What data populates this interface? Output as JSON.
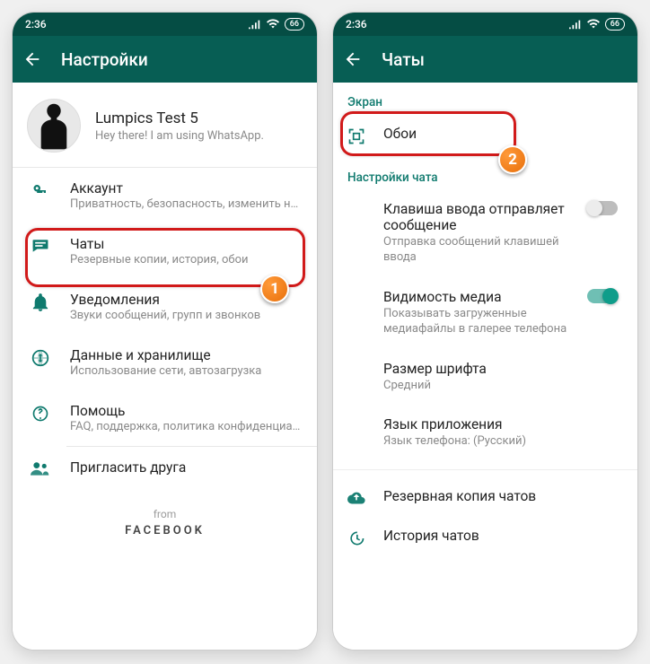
{
  "status": {
    "time": "2:36",
    "battery": "66"
  },
  "left": {
    "appbar": {
      "title": "Настройки"
    },
    "profile": {
      "name": "Lumpics Test 5",
      "status": "Hey there! I am using WhatsApp."
    },
    "items": [
      {
        "title": "Аккаунт",
        "sub": "Приватность, безопасность, изменить номер"
      },
      {
        "title": "Чаты",
        "sub": "Резервные копии, история, обои"
      },
      {
        "title": "Уведомления",
        "sub": "Звуки сообщений, групп и звонков"
      },
      {
        "title": "Данные и хранилище",
        "sub": "Использование сети, автозагрузка"
      },
      {
        "title": "Помощь",
        "sub": "FAQ, поддержка, политика конфиденциальн..."
      },
      {
        "title": "Пригласить друга",
        "sub": ""
      }
    ],
    "footer": {
      "from": "from",
      "brand": "FACEBOOK"
    }
  },
  "right": {
    "appbar": {
      "title": "Чаты"
    },
    "sections": {
      "screen": "Экран",
      "chat_settings": "Настройки чата"
    },
    "wallpaper": {
      "title": "Обои"
    },
    "enter_send": {
      "title": "Клавиша ввода отправляет сообщение",
      "sub": "Отправка сообщений клавишей ввода"
    },
    "media_vis": {
      "title": "Видимость медиа",
      "sub": "Показывать загруженные медиафайлы в галерее телефона"
    },
    "font_size": {
      "title": "Размер шрифта",
      "sub": "Средний"
    },
    "app_lang": {
      "title": "Язык приложения",
      "sub": "Язык телефона: (Русский)"
    },
    "backup": {
      "title": "Резервная копия чатов"
    },
    "history": {
      "title": "История чатов"
    }
  },
  "callouts": {
    "one": "1",
    "two": "2"
  }
}
